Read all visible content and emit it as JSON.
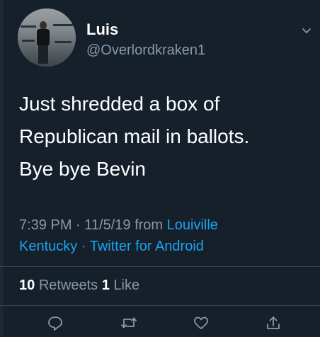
{
  "user": {
    "display_name": "Luis",
    "handle": "@Overlordkraken1"
  },
  "tweet": {
    "text_lines": [
      "Just shredded a box of",
      "Republican mail in ballots.",
      "Bye bye Bevin"
    ],
    "time": "7:39 PM",
    "date": "11/5/19",
    "from_label": "from",
    "location_line1": "Louiville",
    "location_line2": "Kentucky",
    "separator": "·",
    "client": "Twitter for Android"
  },
  "stats": {
    "retweets_count": "10",
    "retweets_label": "Retweets",
    "likes_count": "1",
    "likes_label": "Like"
  },
  "icons": {
    "more": "chevron-down-icon",
    "reply": "reply-icon",
    "retweet": "retweet-icon",
    "like": "heart-icon",
    "share": "share-icon"
  },
  "colors": {
    "background": "#15202b",
    "text": "#ffffff",
    "secondary": "#8899a6",
    "accent": "#1da1f2",
    "divider": "#38444d"
  }
}
